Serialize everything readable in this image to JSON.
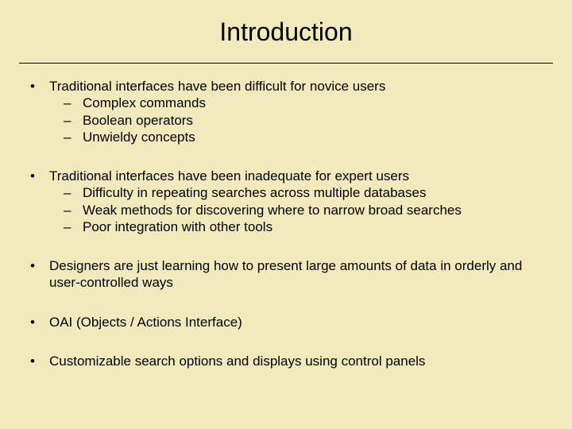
{
  "title": "Introduction",
  "bullets": [
    {
      "text": "Traditional interfaces have been difficult for novice users",
      "sub": [
        "Complex commands",
        "Boolean operators",
        "Unwieldy concepts"
      ]
    },
    {
      "text": "Traditional interfaces have been inadequate for expert users",
      "sub": [
        "Difficulty in repeating searches across multiple databases",
        "Weak methods for discovering where to narrow broad searches",
        "Poor integration with other tools"
      ]
    },
    {
      "text": "Designers are just learning how to present large amounts of data in orderly and user-controlled ways",
      "sub": []
    },
    {
      "text": "OAI (Objects / Actions Interface)",
      "sub": []
    },
    {
      "text": "Customizable search options and displays using control panels",
      "sub": []
    }
  ]
}
